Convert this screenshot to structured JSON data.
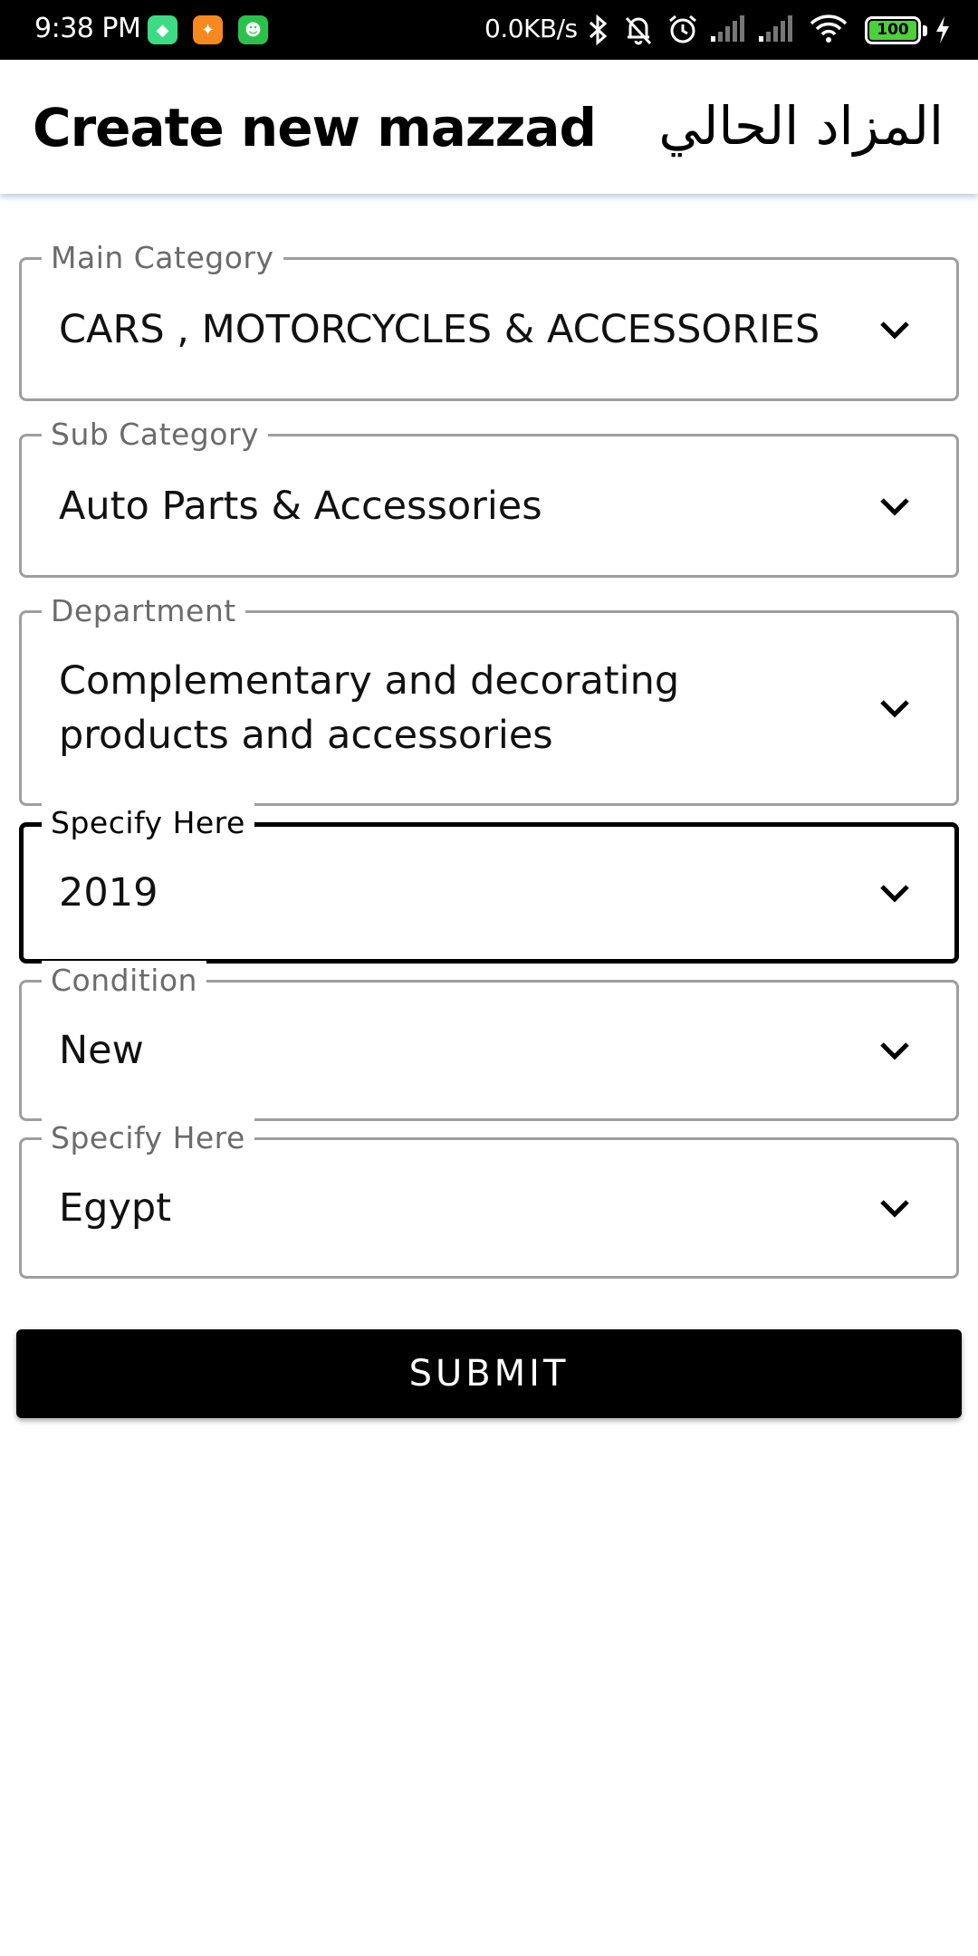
{
  "status_bar": {
    "time": "9:38 PM",
    "network_speed": "0.0KB/s",
    "battery": "100",
    "icons": [
      "android-app-icon",
      "cleaner-app-icon",
      "robot-app-icon",
      "bluetooth-icon",
      "silent-bell-icon",
      "alarm-icon",
      "signal-icon",
      "signal-icon",
      "wifi-icon",
      "battery-icon",
      "charging-icon"
    ]
  },
  "header": {
    "title": "Create new mazzad",
    "arabic_title": "المزاد الحالي"
  },
  "form": {
    "fields": [
      {
        "label": "Main Category",
        "value": "CARS , MOTORCYCLES & ACCESSORIES",
        "focused": false
      },
      {
        "label": "Sub Category",
        "value": "Auto Parts & Accessories",
        "focused": false
      },
      {
        "label": "Department",
        "value": "Complementary and decorating products and accessories",
        "focused": false
      },
      {
        "label": "Specify Here",
        "value": "2019",
        "focused": true
      },
      {
        "label": "Condition",
        "value": "New",
        "focused": false
      },
      {
        "label": "Specify Here",
        "value": "Egypt",
        "focused": false
      }
    ],
    "submit_label": "SUBMIT"
  },
  "colors": {
    "field_border": "#9e9e9e",
    "focused_border": "#000000",
    "button_bg": "#000000",
    "button_text": "#ffffff",
    "status_bar_bg": "#000000"
  }
}
